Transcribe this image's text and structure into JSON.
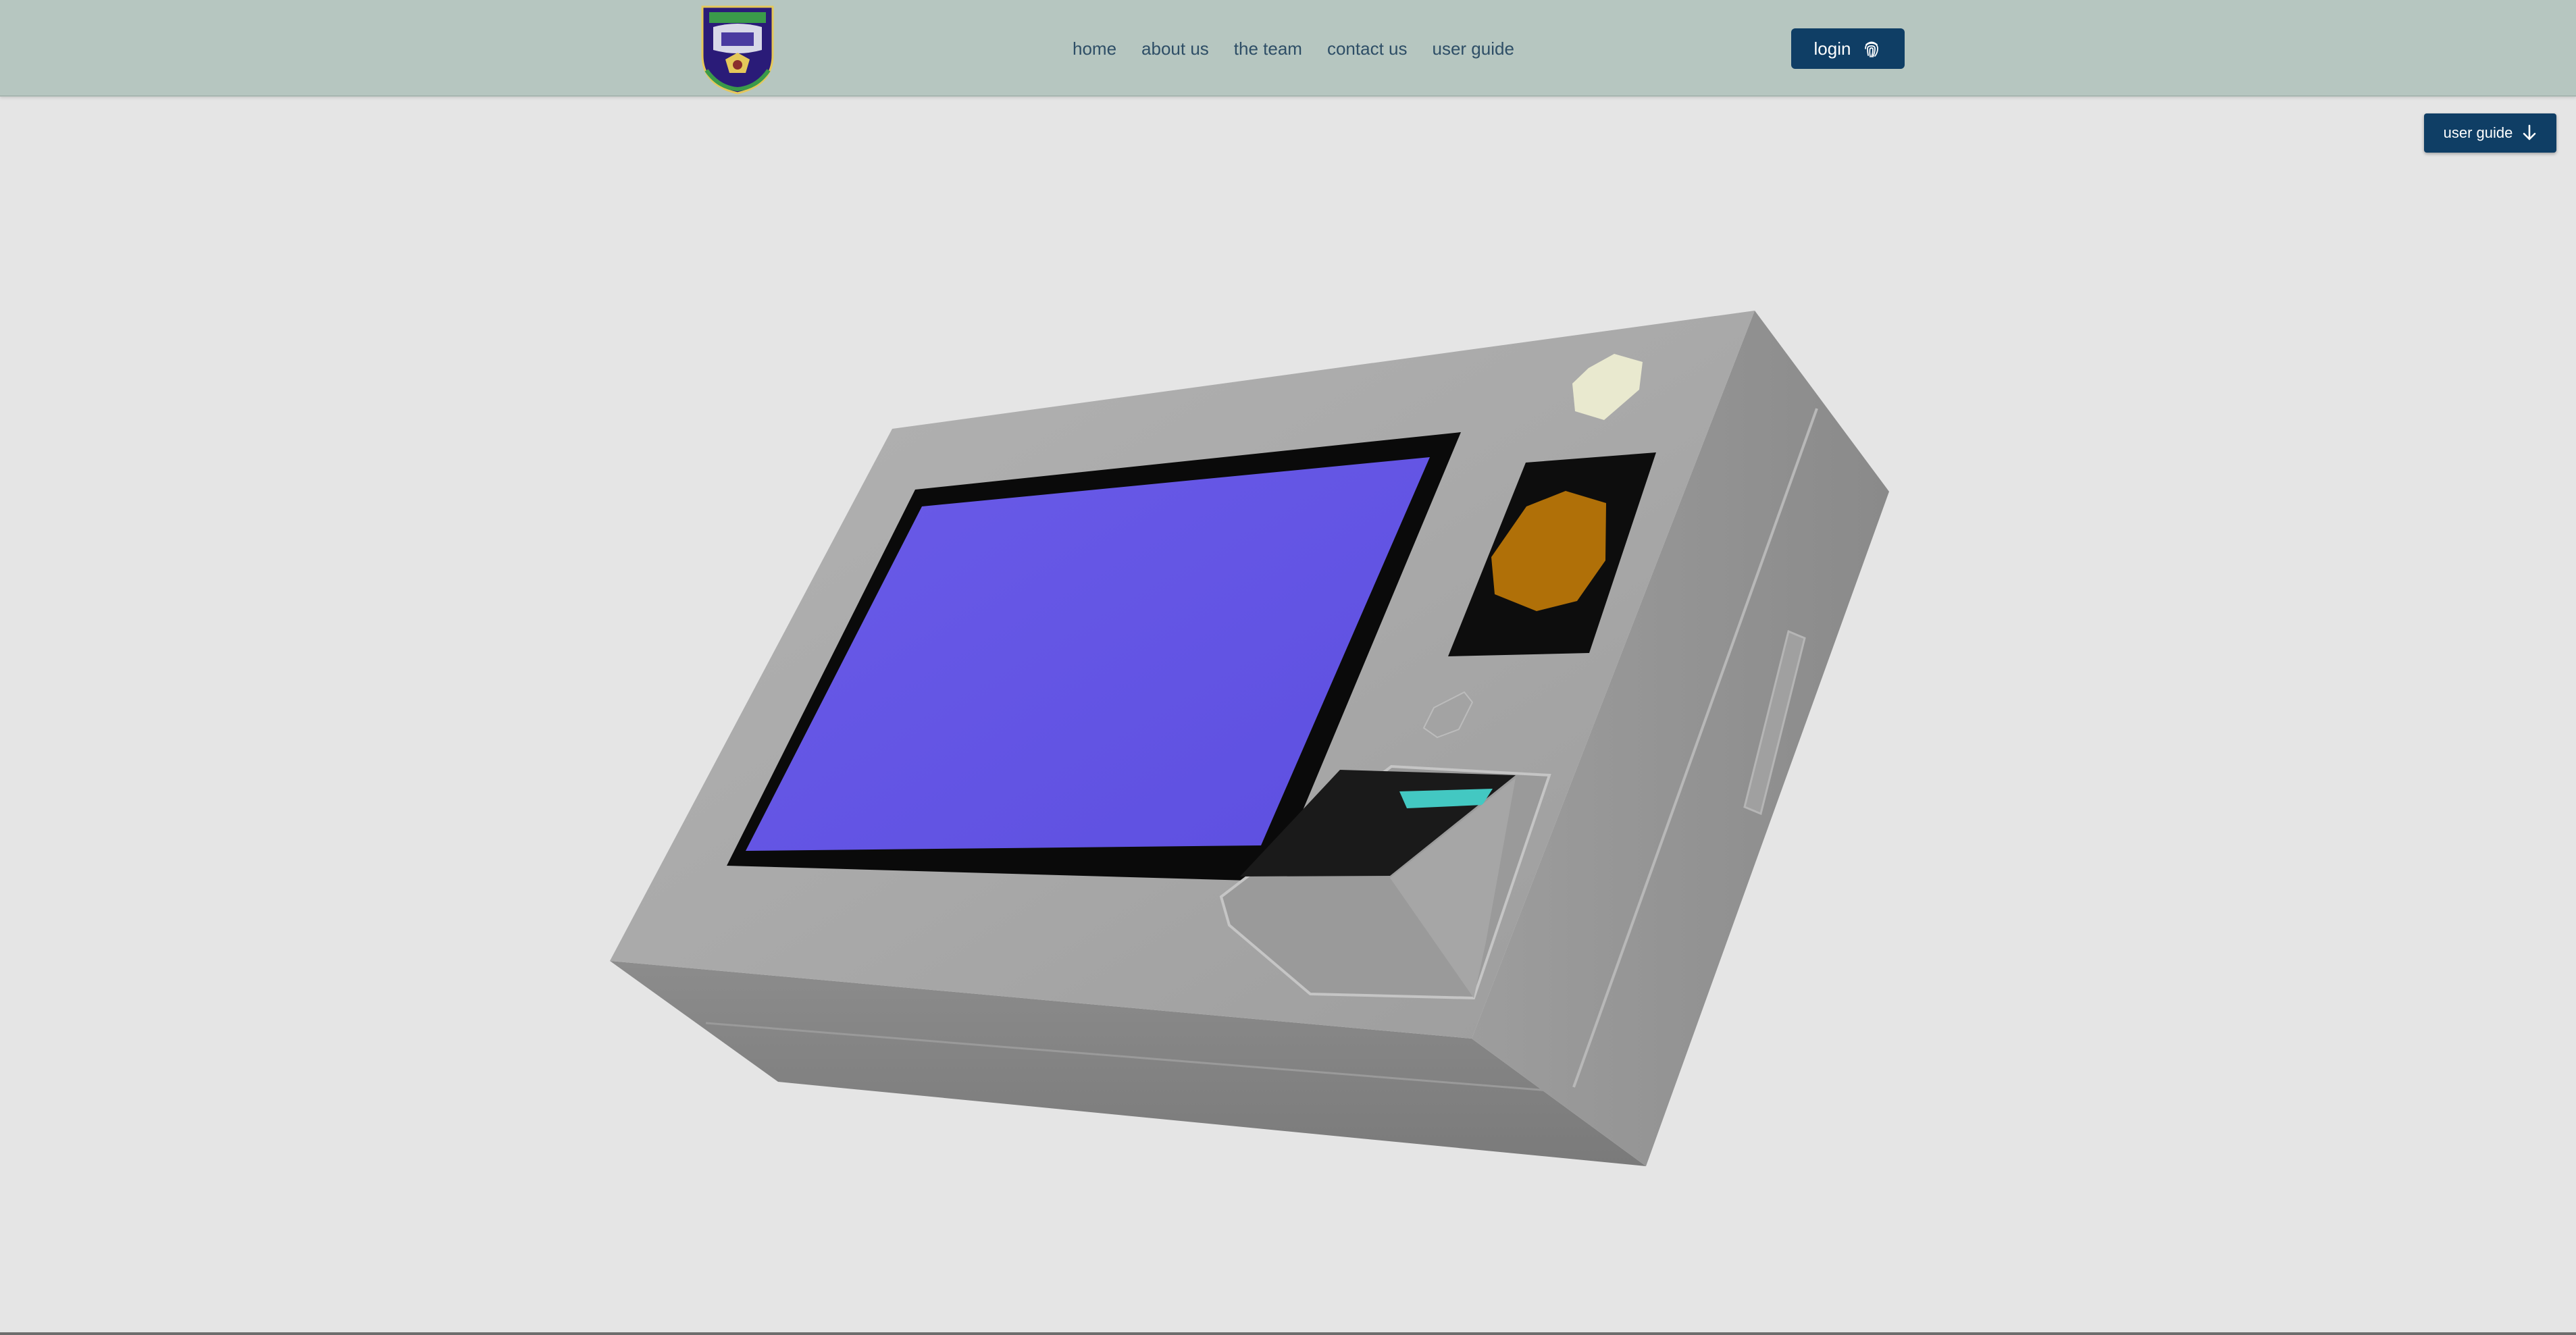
{
  "nav": {
    "links": [
      "home",
      "about us",
      "the team",
      "contact us",
      "user guide"
    ],
    "login_label": "login",
    "login_icon": "fingerprint-icon"
  },
  "floating": {
    "user_guide_label": "user guide",
    "user_guide_icon": "arrow-down-icon"
  },
  "logo": {
    "icon": "university-crest-logo"
  },
  "viewer": {
    "model": "evoting-device-3d-model",
    "colors": {
      "body": "#a8a8a8",
      "screen": "#6355e4",
      "bezel": "#0a0a0a",
      "indicator_amber": "#b07008",
      "indicator_light": "#e9e9cf",
      "scanner_glow": "#43c8c2"
    }
  }
}
